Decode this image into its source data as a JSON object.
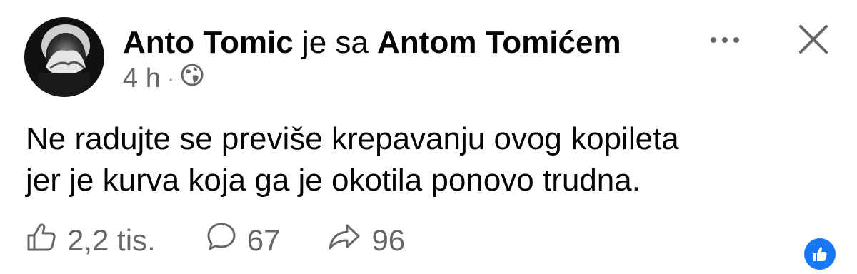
{
  "post": {
    "author_name": "Anto Tomic",
    "relation_text": "je sa",
    "tagged_name": "Antom Tomićem",
    "time": "4 h",
    "separator": "·",
    "audience_icon": "globe-icon",
    "text": "Ne radujte se previše krepavanju ovog kopileta\njer je kurva koja ga je okotila ponovo trudna."
  },
  "actions": {
    "likes": "2,2 tis.",
    "comments": "67",
    "shares": "96"
  },
  "icons": {
    "more": "more-dots-icon",
    "close": "close-icon",
    "like": "thumbs-up-icon",
    "comment": "comment-icon",
    "share": "share-arrow-icon",
    "reaction": "like-reaction-icon"
  },
  "colors": {
    "accent": "#1877f2",
    "secondary_text": "#65676b",
    "primary_text": "#050505"
  }
}
